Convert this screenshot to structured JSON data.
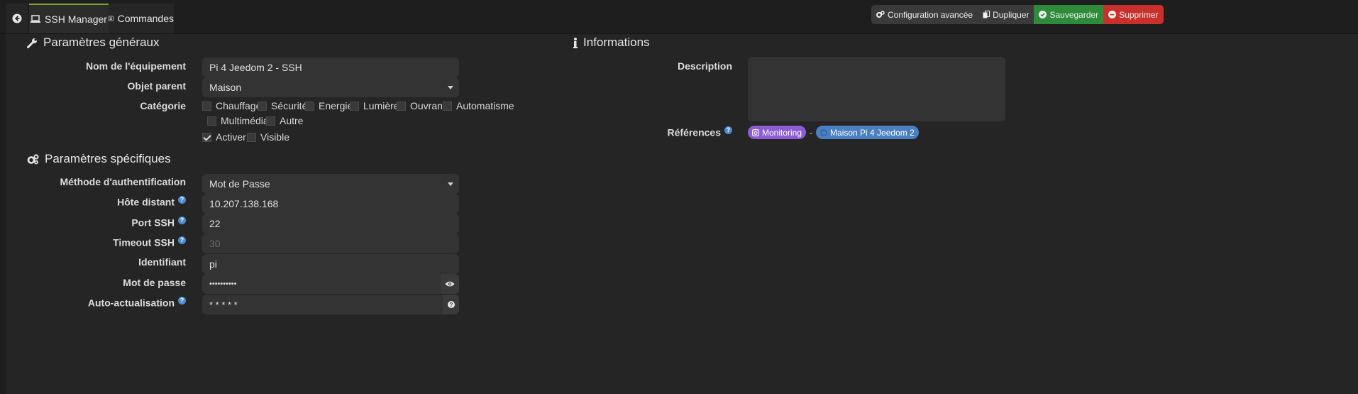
{
  "tabs": [
    {
      "label": "SSH Manager",
      "icon": "laptop-icon",
      "active": true
    },
    {
      "label": "Commandes",
      "icon": "list-icon",
      "active": false
    }
  ],
  "actions": [
    {
      "label": "Configuration avancée",
      "icon": "cogs-icon",
      "color": "#3a3a3a"
    },
    {
      "label": "Dupliquer",
      "icon": "copy-icon",
      "color": "#3a3a3a"
    },
    {
      "label": "Sauvegarder",
      "icon": "check-circle-icon",
      "color": "#2e8b3a"
    },
    {
      "label": "Supprimer",
      "icon": "minus-circle-icon",
      "color": "#c9302c"
    }
  ],
  "general": {
    "title": "Paramètres généraux",
    "name_label": "Nom de l'équipement",
    "name_value": "Pi 4 Jeedom 2 - SSH",
    "parent_label": "Objet parent",
    "parent_value": "Maison",
    "category_label": "Catégorie",
    "categories": [
      {
        "label": "Chauffage",
        "checked": false
      },
      {
        "label": "Sécurité",
        "checked": false
      },
      {
        "label": "Energie",
        "checked": false
      },
      {
        "label": "Lumière",
        "checked": false
      },
      {
        "label": "Ouvrant",
        "checked": false
      },
      {
        "label": "Automatisme",
        "checked": false
      },
      {
        "label": "Multimédia",
        "checked": false
      },
      {
        "label": "Autre",
        "checked": false
      }
    ],
    "activate_label": "Activer",
    "activate_checked": true,
    "visible_label": "Visible",
    "visible_checked": false
  },
  "specific": {
    "title": "Paramètres spécifiques",
    "auth_label": "Méthode d'authentification",
    "auth_value": "Mot de Passe",
    "host_label": "Hôte distant",
    "host_value": "10.207.138.168",
    "port_label": "Port SSH",
    "port_value": "22",
    "timeout_label": "Timeout SSH",
    "timeout_placeholder": "30",
    "user_label": "Identifiant",
    "user_value": "pi",
    "password_label": "Mot de passe",
    "password_value": "••••••••••",
    "refresh_label": "Auto-actualisation",
    "refresh_value": "* * * * *"
  },
  "info": {
    "title": "Informations",
    "description_label": "Description",
    "references_label": "Références",
    "references": [
      {
        "label": "Monitoring",
        "icon": "plugin-icon",
        "color": "#8e5bd6"
      },
      {
        "label": "Maison Pi 4 Jeedom 2",
        "icon": "object-icon",
        "color": "#4a7fc1"
      }
    ],
    "separator": "-"
  },
  "colors": {
    "accent": "#7ea52b",
    "help": "#4b8cd1",
    "save": "#2e8b3a",
    "delete": "#c9302c"
  }
}
